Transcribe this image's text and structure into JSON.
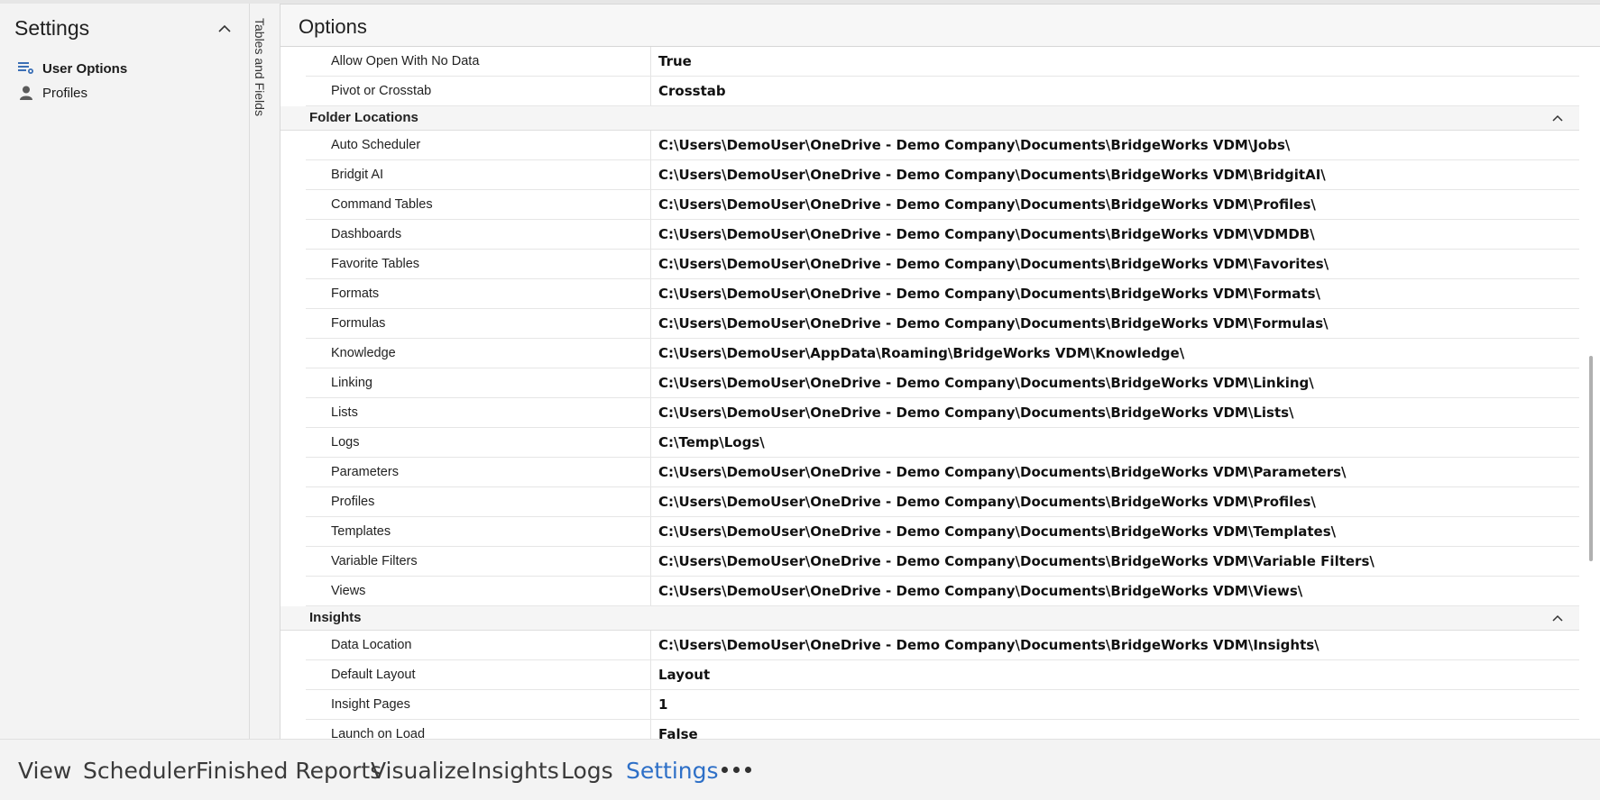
{
  "sidebar": {
    "title": "Settings",
    "items": [
      {
        "label": "User Options",
        "icon": "user-options-icon",
        "active": true
      },
      {
        "label": "Profiles",
        "icon": "person-icon",
        "active": false
      }
    ],
    "vertical_tab": "Tables and Fields"
  },
  "options": {
    "title": "Options",
    "general_rows": [
      {
        "name": "Allow Open With No Data",
        "value": "True"
      },
      {
        "name": "Pivot or Crosstab",
        "value": "Crosstab"
      }
    ],
    "folder_locations": {
      "label": "Folder Locations",
      "rows": [
        {
          "name": "Auto Scheduler",
          "value": "C:\\Users\\DemoUser\\OneDrive - Demo Company\\Documents\\BridgeWorks VDM\\Jobs\\"
        },
        {
          "name": "Bridgit AI",
          "value": "C:\\Users\\DemoUser\\OneDrive - Demo Company\\Documents\\BridgeWorks VDM\\BridgitAI\\"
        },
        {
          "name": "Command Tables",
          "value": "C:\\Users\\DemoUser\\OneDrive - Demo Company\\Documents\\BridgeWorks VDM\\Profiles\\"
        },
        {
          "name": "Dashboards",
          "value": "C:\\Users\\DemoUser\\OneDrive - Demo Company\\Documents\\BridgeWorks VDM\\VDMDB\\"
        },
        {
          "name": "Favorite Tables",
          "value": "C:\\Users\\DemoUser\\OneDrive - Demo Company\\Documents\\BridgeWorks VDM\\Favorites\\"
        },
        {
          "name": "Formats",
          "value": "C:\\Users\\DemoUser\\OneDrive - Demo Company\\Documents\\BridgeWorks VDM\\Formats\\"
        },
        {
          "name": "Formulas",
          "value": "C:\\Users\\DemoUser\\OneDrive - Demo Company\\Documents\\BridgeWorks VDM\\Formulas\\"
        },
        {
          "name": "Knowledge",
          "value": "C:\\Users\\DemoUser\\AppData\\Roaming\\BridgeWorks VDM\\Knowledge\\"
        },
        {
          "name": "Linking",
          "value": "C:\\Users\\DemoUser\\OneDrive - Demo Company\\Documents\\BridgeWorks VDM\\Linking\\"
        },
        {
          "name": "Lists",
          "value": "C:\\Users\\DemoUser\\OneDrive - Demo Company\\Documents\\BridgeWorks VDM\\Lists\\"
        },
        {
          "name": "Logs",
          "value": "C:\\Temp\\Logs\\"
        },
        {
          "name": "Parameters",
          "value": "C:\\Users\\DemoUser\\OneDrive - Demo Company\\Documents\\BridgeWorks VDM\\Parameters\\"
        },
        {
          "name": "Profiles",
          "value": "C:\\Users\\DemoUser\\OneDrive - Demo Company\\Documents\\BridgeWorks VDM\\Profiles\\"
        },
        {
          "name": "Templates",
          "value": "C:\\Users\\DemoUser\\OneDrive - Demo Company\\Documents\\BridgeWorks VDM\\Templates\\"
        },
        {
          "name": "Variable Filters",
          "value": "C:\\Users\\DemoUser\\OneDrive - Demo Company\\Documents\\BridgeWorks VDM\\Variable Filters\\"
        },
        {
          "name": "Views",
          "value": "C:\\Users\\DemoUser\\OneDrive - Demo Company\\Documents\\BridgeWorks VDM\\Views\\"
        }
      ]
    },
    "insights": {
      "label": "Insights",
      "rows": [
        {
          "name": "Data Location",
          "value": "C:\\Users\\DemoUser\\OneDrive - Demo Company\\Documents\\BridgeWorks VDM\\Insights\\"
        },
        {
          "name": "Default Layout",
          "value": "Layout"
        },
        {
          "name": "Insight Pages",
          "value": "1"
        },
        {
          "name": "Launch on Load",
          "value": "False"
        }
      ]
    }
  },
  "bottom_tabs": [
    {
      "label": "View",
      "active": false
    },
    {
      "label": "Scheduler",
      "active": false
    },
    {
      "label": "Finished Reports",
      "active": false
    },
    {
      "label": "Visualize",
      "active": false
    },
    {
      "label": "Insights",
      "active": false
    },
    {
      "label": "Logs",
      "active": false
    },
    {
      "label": "Settings",
      "active": true
    }
  ],
  "colors": {
    "accent": "#2d6fc7",
    "panel_bg": "#f3f3f3",
    "grid_bg": "#ffffff"
  }
}
